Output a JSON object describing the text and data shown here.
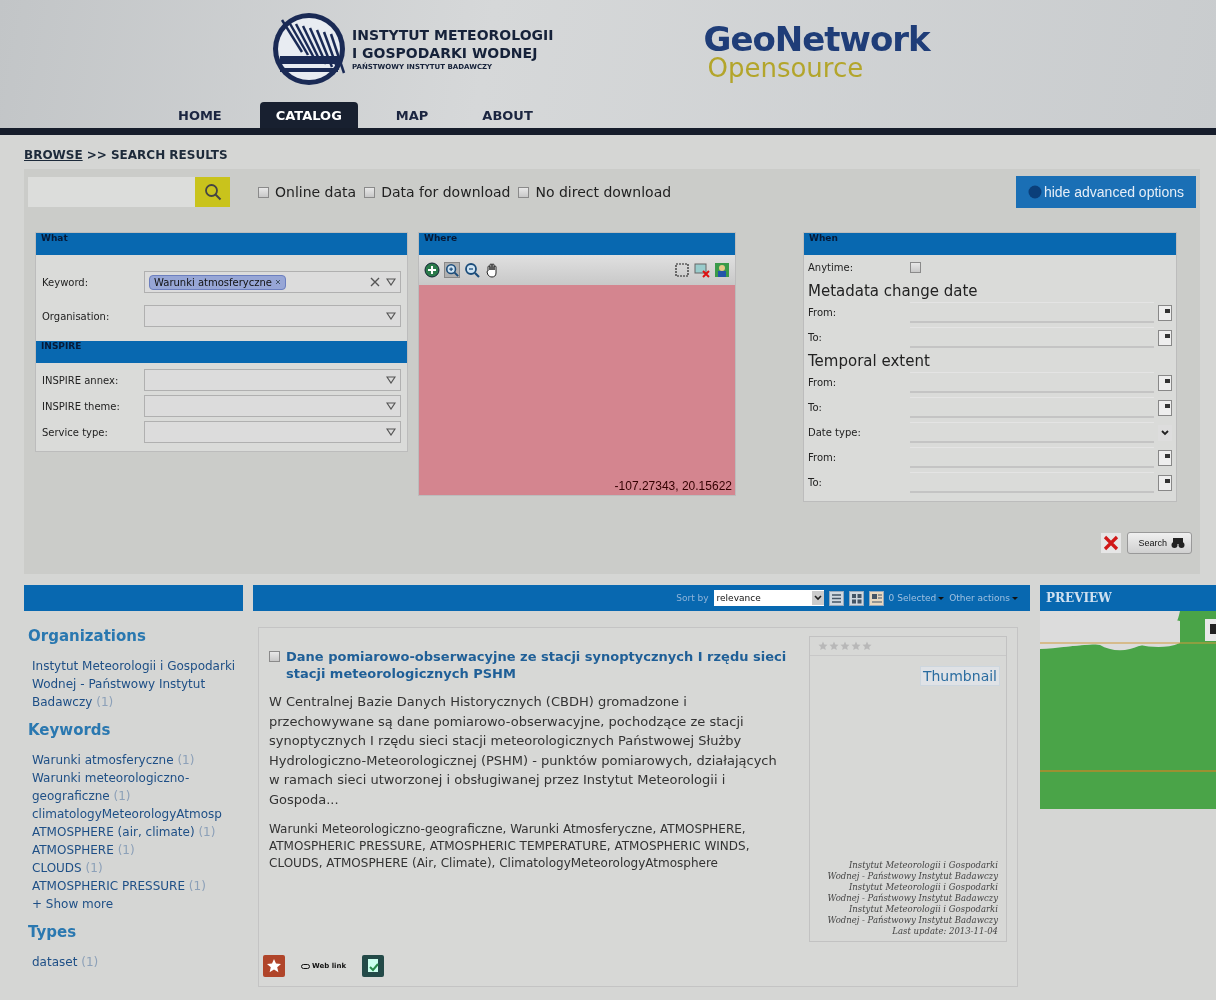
{
  "header": {
    "institute_lines": [
      "INSTYTUT METEOROLOGII",
      "I GOSPODARKI WODNEJ",
      "PAŃSTWOWY INSTYTUT BADAWCZY"
    ],
    "brand": "GeoNetwork",
    "brand_sub": "Opensource",
    "nav": [
      {
        "label": "HOME",
        "selected": false
      },
      {
        "label": "CATALOG",
        "selected": true
      },
      {
        "label": "MAP",
        "selected": false
      },
      {
        "label": "ABOUT",
        "selected": false
      }
    ]
  },
  "breadcrumb": {
    "link": "BROWSE",
    "current": ">> SEARCH RESULTS"
  },
  "search": {
    "filters": [
      {
        "label": "Online data",
        "checked": false
      },
      {
        "label": "Data for download",
        "checked": false
      },
      {
        "label": "No direct download",
        "checked": false
      }
    ],
    "advanced_button": "hide advanced options"
  },
  "what": {
    "title": "What",
    "fields": [
      {
        "label": "Keyword:",
        "tag": "Warunki atmosferyczne"
      },
      {
        "label": "Organisation:"
      }
    ]
  },
  "inspire": {
    "title": "INSPIRE",
    "fields": [
      {
        "label": "INSPIRE annex:"
      },
      {
        "label": "INSPIRE theme:"
      },
      {
        "label": "Service type:"
      }
    ]
  },
  "where": {
    "title": "Where",
    "tools": [
      {
        "kind": "extent",
        "selected": false
      },
      {
        "kind": "zoom-in",
        "selected": true
      },
      {
        "kind": "zoom-out",
        "selected": false
      },
      {
        "kind": "pan",
        "selected": false
      },
      {
        "kind": "box",
        "selected": false
      },
      {
        "kind": "remove",
        "selected": false
      },
      {
        "kind": "layers",
        "selected": false
      }
    ],
    "coordinates": "-107.27343, 20.15622"
  },
  "when": {
    "title": "When",
    "anytime": {
      "label": "Anytime:",
      "checked": false
    },
    "sections": [
      {
        "heading": "Metadata change date",
        "fields": [
          {
            "label": "From:",
            "kind": "date"
          },
          {
            "label": "To:",
            "kind": "date"
          }
        ]
      },
      {
        "heading": "Temporal extent",
        "fields": [
          {
            "label": "From:",
            "kind": "date"
          },
          {
            "label": "To:",
            "kind": "date"
          },
          {
            "label": "Date type:",
            "kind": "select"
          },
          {
            "label": "From:",
            "kind": "date"
          },
          {
            "label": "To:",
            "kind": "date"
          }
        ]
      }
    ]
  },
  "actions": {
    "search_button": "Search"
  },
  "facets": [
    {
      "title": "Organizations",
      "items": [
        {
          "label": "Instytut Meteorologii i Gospodarki Wodnej - Państwowy Instytut Badawczy",
          "count": "(1)"
        }
      ]
    },
    {
      "title": "Keywords",
      "items": [
        {
          "label": "Warunki atmosferyczne",
          "count": "(1)"
        },
        {
          "label": "Warunki meteorologiczno-geograficzne",
          "count": "(1)"
        },
        {
          "label": "climatologyMeteorologyAtmosp"
        },
        {
          "label": "ATMOSPHERE (air, climate)",
          "count": "(1)"
        },
        {
          "label": "ATMOSPHERE",
          "count": "(1)"
        },
        {
          "label": "CLOUDS",
          "count": "(1)"
        },
        {
          "label": "ATMOSPHERIC PRESSURE",
          "count": "(1)"
        }
      ],
      "more": "+ Show more"
    },
    {
      "title": "Types",
      "items": [
        {
          "label": "dataset",
          "count": "(1)"
        }
      ]
    }
  ],
  "results_toolbar": {
    "sort_label": "Sort by",
    "sort_value": "relevance",
    "view_modes": [
      {
        "kind": "list",
        "selected": false
      },
      {
        "kind": "grid",
        "selected": false
      },
      {
        "kind": "detail",
        "selected": true
      }
    ],
    "selected_count": "0 Selected",
    "other_actions": "Other actions"
  },
  "results": [
    {
      "checked": false,
      "title": "Dane pomiarowo-obserwacyjne ze stacji synoptycznych I rzędu sieci stacji meteorologicznych PSHM",
      "abstract": "W Centralnej Bazie Danych Historycznych (CBDH) gromadzone i przechowywane są dane pomiarowo-obserwacyjne, pochodzące ze stacji synoptycznych I rzędu sieci stacji meteorologicznych Państwowej Służby Hydrologiczno-Meteorologicznej (PSHM) - punktów pomiarowych, działających w ramach sieci utworzonej i obsługiwanej przez Instytut Meteorologii i Gospoda...",
      "keywords": "Warunki Meteorologiczno-geograficzne, Warunki Atmosferyczne, ATMOSPHERE, ATMOSPHERIC PRESSURE, ATMOSPHERIC TEMPERATURE, ATMOSPHERIC WINDS, CLOUDS, ATMOSPHERE (Air, Climate), ClimatologyMeteorologyAtmosphere",
      "stars": 0,
      "thumbnail": "Thumbnail",
      "contacts": [
        "Instytut Meteorologii i Gospodarki Wodnej - Państwowy Instytut Badawczy",
        "Instytut Meteorologii i Gospodarki Wodnej - Państwowy Instytut Badawczy",
        "Instytut Meteorologii i Gospodarki Wodnej - Państwowy Instytut Badawczy"
      ],
      "last_update": "Last update: 2013-11-04",
      "links": [
        {
          "kind": "favorite"
        },
        {
          "kind": "web",
          "label": "Web link"
        },
        {
          "kind": "document"
        }
      ]
    }
  ],
  "preview": {
    "title": "PREVIEW"
  }
}
